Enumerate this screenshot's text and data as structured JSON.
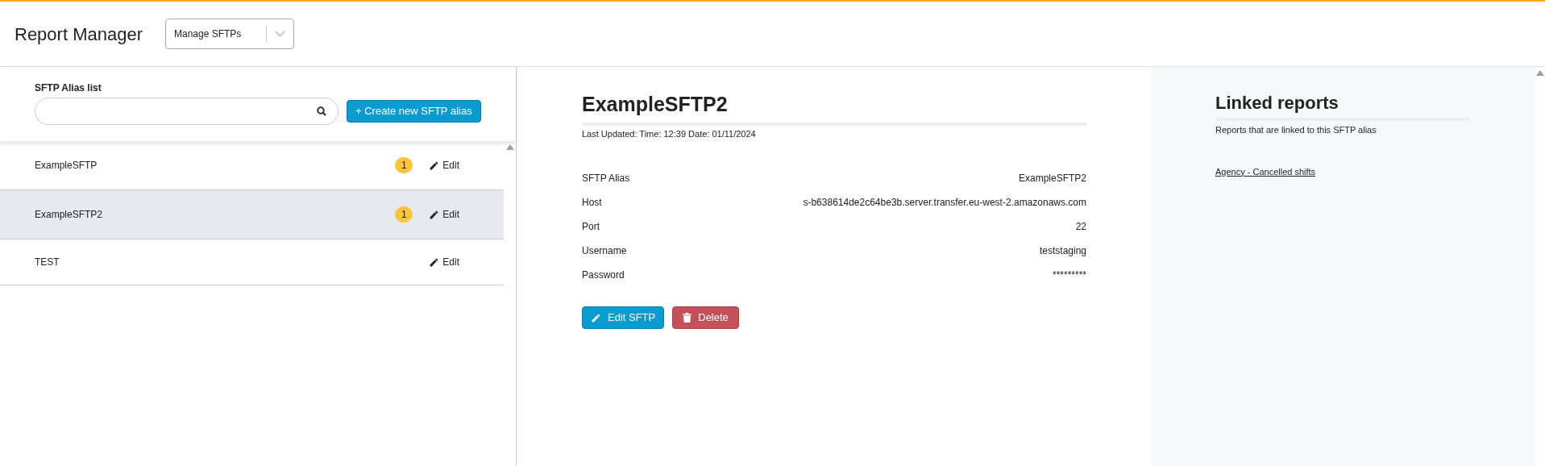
{
  "header": {
    "title": "Report Manager",
    "dropdown": {
      "value": "Manage SFTPs"
    }
  },
  "alias_list": {
    "heading": "SFTP Alias list",
    "create_button": "+ Create new SFTP alias",
    "items": [
      {
        "name": "ExampleSFTP",
        "count": "1",
        "edit": "Edit",
        "selected": false
      },
      {
        "name": "ExampleSFTP2",
        "count": "1",
        "edit": "Edit",
        "selected": true
      },
      {
        "name": "TEST",
        "edit": "Edit",
        "selected": false
      }
    ]
  },
  "detail": {
    "title": "ExampleSFTP2",
    "last_updated": "Last Updated: Time: 12:39 Date: 01/11/2024",
    "fields": [
      {
        "label": "SFTP Alias",
        "value": "ExampleSFTP2"
      },
      {
        "label": "Host",
        "value": "s-b638614de2c64be3b.server.transfer.eu-west-2.amazonaws.com"
      },
      {
        "label": "Port",
        "value": "22"
      },
      {
        "label": "Username",
        "value": "teststaging"
      },
      {
        "label": "Password",
        "value": "*********"
      }
    ],
    "edit_button": "Edit SFTP",
    "delete_button": "Delete"
  },
  "linked_reports": {
    "title": "Linked reports",
    "subtitle": "Reports that are linked to this SFTP alias",
    "reports": [
      "Agency - Cancelled shifts"
    ]
  }
}
